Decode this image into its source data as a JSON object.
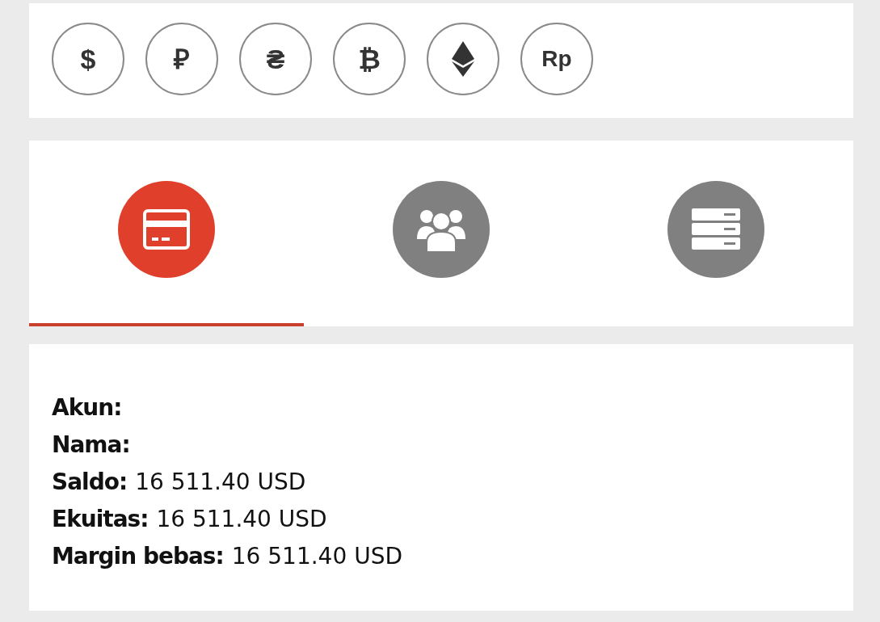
{
  "currencies": [
    {
      "kind": "text",
      "symbol": "$"
    },
    {
      "kind": "text",
      "symbol": "₽"
    },
    {
      "kind": "text",
      "symbol": "₴"
    },
    {
      "kind": "text",
      "symbol": "₿"
    },
    {
      "kind": "ethereum"
    },
    {
      "kind": "text",
      "symbol": "Rp"
    }
  ],
  "tabs": [
    {
      "kind": "card",
      "selected": true
    },
    {
      "kind": "people",
      "selected": false
    },
    {
      "kind": "server",
      "selected": false
    }
  ],
  "account": [
    {
      "label": "Akun:"
    },
    {
      "label": "Nama:"
    },
    {
      "label": "Saldo:",
      "value": "16 511.40 USD"
    },
    {
      "label": "Ekuitas:",
      "value": "16 511.40 USD"
    },
    {
      "label": "Margin bebas:",
      "value": "16 511.40 USD"
    }
  ]
}
